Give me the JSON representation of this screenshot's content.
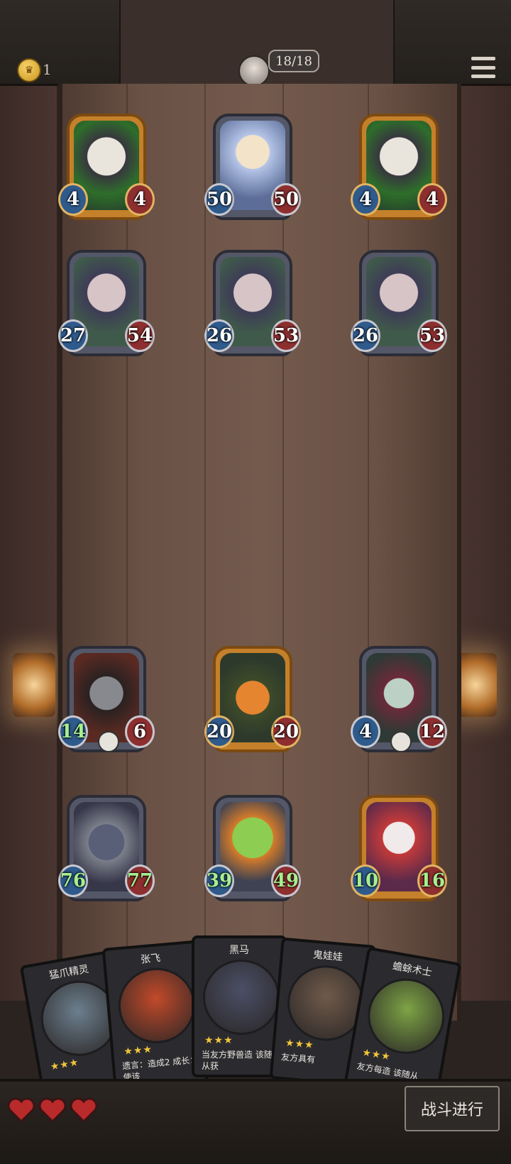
{
  "header": {
    "coins": "1",
    "bubble": "18/18"
  },
  "colors": {
    "atk": "#2f5a8c",
    "hp": "#8e2f2f",
    "buffed": "#a6ef8f",
    "gold_frame": "#c4802a"
  },
  "enemy": [
    {
      "id": "e1",
      "name": "skull-unit",
      "atk": "4",
      "hp": "4",
      "frame": "gold"
    },
    {
      "id": "e2",
      "name": "princess-unit",
      "atk": "50",
      "hp": "50",
      "frame": "silver"
    },
    {
      "id": "e3",
      "name": "skull-unit",
      "atk": "4",
      "hp": "4",
      "frame": "gold"
    },
    {
      "id": "e4",
      "name": "ogre-unit",
      "atk": "27",
      "hp": "54",
      "frame": "silver"
    },
    {
      "id": "e5",
      "name": "ogre-unit",
      "atk": "26",
      "hp": "53",
      "frame": "silver"
    },
    {
      "id": "e6",
      "name": "ogre-unit",
      "atk": "26",
      "hp": "53",
      "frame": "silver"
    }
  ],
  "player": [
    {
      "id": "p1",
      "name": "raccoon-unit",
      "atk": "14",
      "hp": "6",
      "frame": "silver",
      "buff_atk": true,
      "buff_hp": false,
      "skull": true
    },
    {
      "id": "p2",
      "name": "pumpkin-unit",
      "atk": "20",
      "hp": "20",
      "frame": "gold",
      "buff_atk": false,
      "buff_hp": false,
      "skull": false
    },
    {
      "id": "p3",
      "name": "witch-unit",
      "atk": "4",
      "hp": "12",
      "frame": "silver",
      "buff_atk": false,
      "buff_hp": false,
      "skull": true
    },
    {
      "id": "p4",
      "name": "horse-unit",
      "atk": "76",
      "hp": "77",
      "frame": "silver",
      "buff_atk": true,
      "buff_hp": true,
      "skull": false
    },
    {
      "id": "p5",
      "name": "frog-unit",
      "atk": "39",
      "hp": "49",
      "frame": "silver",
      "buff_atk": true,
      "buff_hp": true,
      "skull": false
    },
    {
      "id": "p6",
      "name": "clown-unit",
      "atk": "10",
      "hp": "16",
      "frame": "gold",
      "buff_atk": true,
      "buff_hp": true,
      "skull": false
    }
  ],
  "hand": [
    {
      "name": "猛爪精灵",
      "stars": "★★★",
      "desc": ""
    },
    {
      "name": "张飞",
      "stars": "★★★",
      "desc": "遗言：造成2 成长：使该"
    },
    {
      "name": "黑马",
      "stars": "★★★",
      "desc": "当友方野兽造 该随从获"
    },
    {
      "name": "鬼娃娃",
      "stars": "★★★",
      "desc": "友方具有"
    },
    {
      "name": "蟾蜍术士",
      "stars": "★★★",
      "desc": "友方每造 该随从"
    }
  ],
  "lives": 3,
  "fight_label": "战斗进行"
}
